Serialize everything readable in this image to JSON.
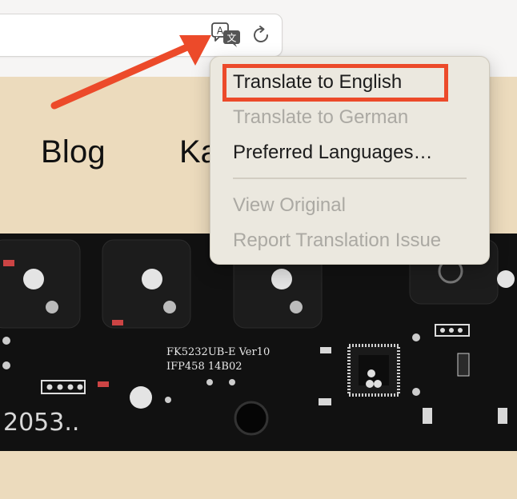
{
  "toolbar": {
    "translate_icon": "translate-icon",
    "reload_icon": "reload-icon"
  },
  "nav": {
    "blog": "Blog",
    "partial": "Ka"
  },
  "pcb": {
    "label_line1": "FK5232UB-E Ver10",
    "label_line2": "IFP458 14B02",
    "number": "2053.."
  },
  "menu": {
    "items": [
      {
        "label": "Translate to English",
        "enabled": true
      },
      {
        "label": "Translate to German",
        "enabled": false
      },
      {
        "label": "Preferred Languages…",
        "enabled": true
      },
      {
        "label": "View Original",
        "enabled": false
      },
      {
        "label": "Report Translation Issue",
        "enabled": false
      }
    ]
  },
  "annotation": {
    "arrow_color": "#ec4a2a",
    "highlight_color": "#ec4a2a"
  }
}
